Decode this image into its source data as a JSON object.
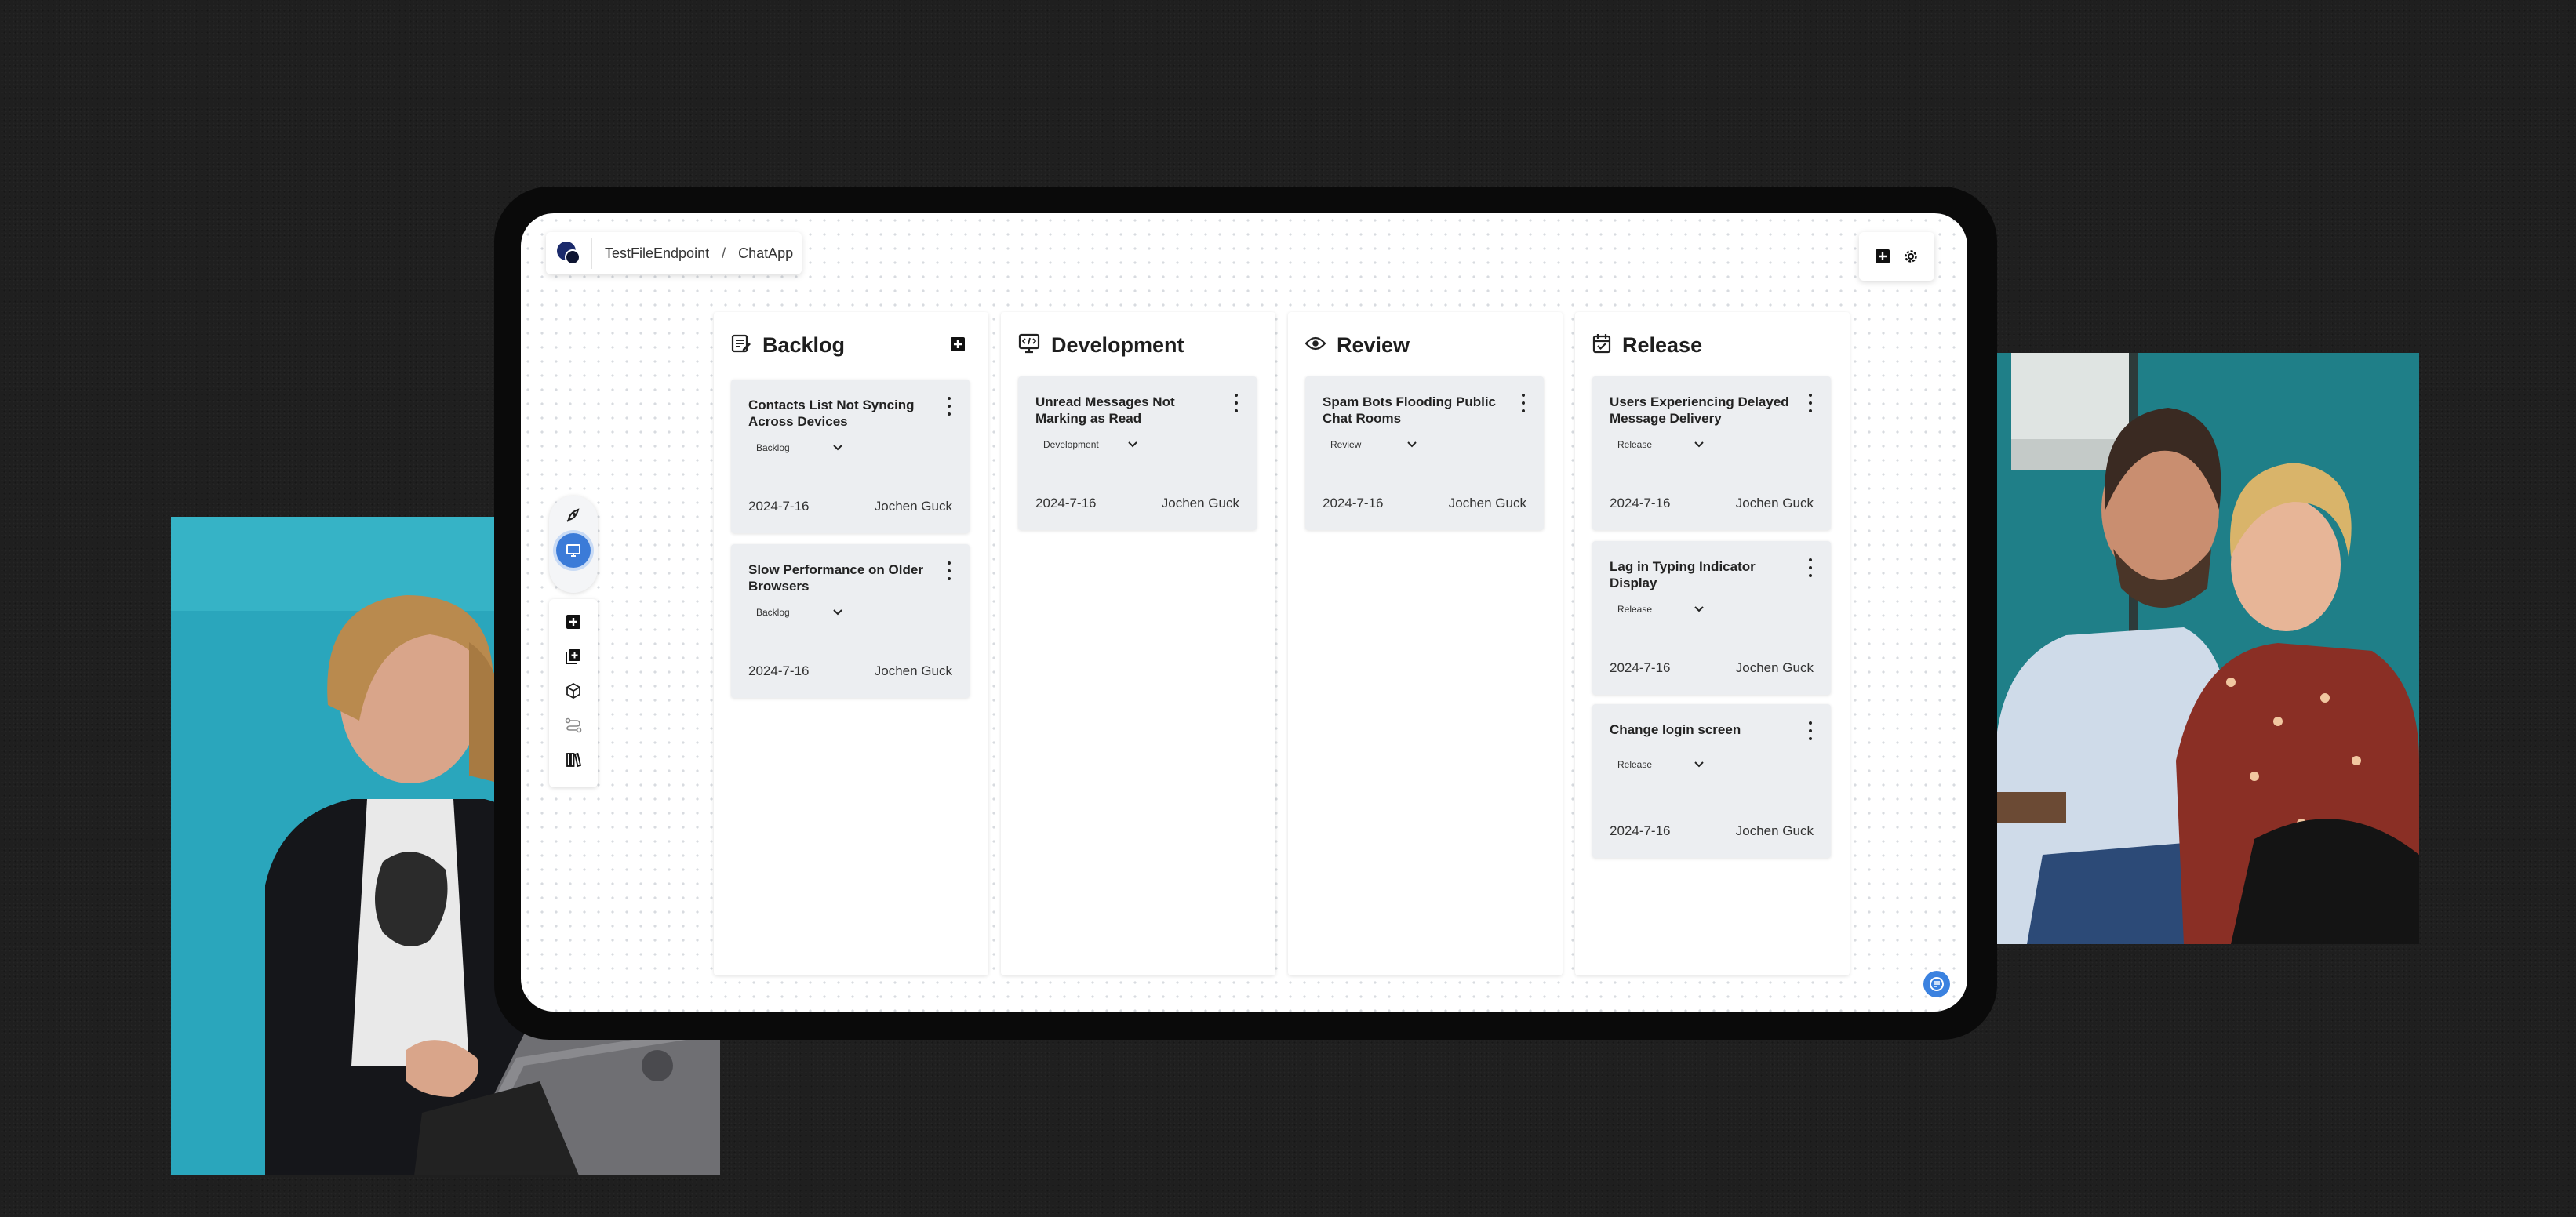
{
  "breadcrumb": {
    "project": "TestFileEndpoint",
    "separator": "/",
    "app": "ChatApp"
  },
  "columns": [
    {
      "title": "Backlog",
      "icon": "edit-note-icon",
      "cards": [
        {
          "title": "Contacts List Not Syncing Across Devices",
          "status": "Backlog",
          "date": "2024-7-16",
          "assignee": "Jochen Guck"
        },
        {
          "title": "Slow Performance on Older Browsers",
          "status": "Backlog",
          "date": "2024-7-16",
          "assignee": "Jochen Guck"
        }
      ]
    },
    {
      "title": "Development",
      "icon": "code-monitor-icon",
      "cards": [
        {
          "title": "Unread Messages Not Marking as Read",
          "status": "Development",
          "date": "2024-7-16",
          "assignee": "Jochen Guck"
        }
      ]
    },
    {
      "title": "Review",
      "icon": "eye-icon",
      "cards": [
        {
          "title": "Spam Bots Flooding Public Chat Rooms",
          "status": "Review",
          "date": "2024-7-16",
          "assignee": "Jochen Guck"
        }
      ]
    },
    {
      "title": "Release",
      "icon": "calendar-check-icon",
      "cards": [
        {
          "title": "Users Experiencing Delayed Message Delivery",
          "status": "Release",
          "date": "2024-7-16",
          "assignee": "Jochen Guck"
        },
        {
          "title": "Lag in Typing Indicator Display",
          "status": "Release",
          "date": "2024-7-16",
          "assignee": "Jochen Guck"
        },
        {
          "title": "Change login screen",
          "status": "Release",
          "date": "2024-7-16",
          "assignee": "Jochen Guck"
        }
      ]
    }
  ],
  "colors": {
    "accent": "#3b7bd8",
    "card_bg": "#eceef1",
    "logo": "#1b2a6b"
  }
}
